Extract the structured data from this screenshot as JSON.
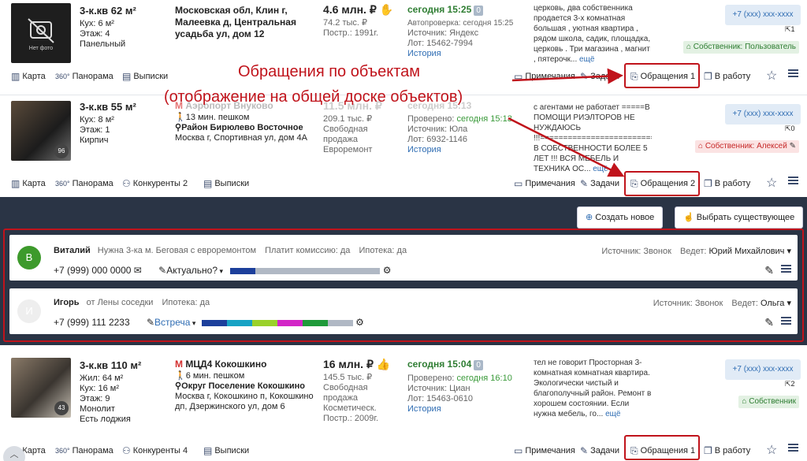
{
  "listings": [
    {
      "rooms": "3-к.кв 62 м²",
      "area1": "Кух: 6 м²",
      "area2": "Этаж: 4",
      "area3": "Панельный",
      "addr1": "Московская обл, Клин г,",
      "addr2": "Малеевка д, Центральная",
      "addr3": "усадьба ул, дом 12",
      "price": "4.6 млн. ₽",
      "price_m2": "74.2 тыс. ₽",
      "built": "Постр.: 1991г.",
      "time": "сегодня 15:25",
      "time_badge": "0",
      "checked": "Автопроверка: сегодня 15:25",
      "source": "Источник: Яндекс",
      "lot": "Лот: 15462-7994",
      "history": "История",
      "desc": "церковь, два собственника продается 3-х комнатная большая , уютная квартира , рядом школа, садик, площадка, церковь . Три магазина , магнит , пятерочк...",
      "more": "ещё",
      "phone": "+7 (xxx) xxx-xxxx",
      "phone_count": "1",
      "owner": "Собственник: Пользователь",
      "nophoto": "Нет фото"
    },
    {
      "rooms": "3-к.кв 55 м²",
      "area1": "Кух: 8 м²",
      "area2": "Этаж: 1",
      "area3": "Кирпич",
      "metro": "Аэропорт Внуково",
      "walk": "13 мин. пешком",
      "district": "Район Бирюлево Восточное",
      "addr": "Москва г, Спортивная ул, дом 4А",
      "price": "11.5 млн. ₽",
      "price_m2": "209.1 тыс. ₽",
      "sale1": "Свободная",
      "sale2": "продажа",
      "sale3": "Евроремонт",
      "time": "сегодня 15:13",
      "checked_label": "Проверено:",
      "checked_time": "сегодня 15:13",
      "source": "Источник: Юла",
      "lot": "Лот: 6932-1146",
      "history": "История",
      "desc1": "с агентами не работает =====В ПОМОЩИ РИЭЛТОРОВ НЕ НУЖДАЮСЬ",
      "desc2": "!!!================================",
      "desc3": "В СОБСТВЕННОСТИ БОЛЕЕ 5 ЛЕТ !!! ВСЯ МЕБЕЛЬ И ТЕХНИКА ОС...",
      "more": "ещё",
      "phone": "+7 (xxx) xxx-xxxx",
      "phone_count": "0",
      "owner": "Собственник: Алексей",
      "photo_count": "96"
    },
    {
      "rooms": "3-к.кв 110 м²",
      "area1": "Жил: 64 м²",
      "area2": "Кух: 16 м²",
      "area3": "Этаж: 9",
      "area4": "Монолит",
      "area5": "Есть лоджия",
      "metro": "МЦД4 Кокошкино",
      "walk": "6 мин. пешком",
      "district": "Округ Поселение Кокошкино",
      "addr1": "Москва г, Кокошкино п, Кокошкино",
      "addr2": "дп, Дзержинского ул, дом 6",
      "price": "16 млн. ₽",
      "price_m2": "145.5 тыс. ₽",
      "sale1": "Свободная",
      "sale2": "продажа",
      "sale3": "Косметическ.",
      "sale4": "Постр.: 2009г.",
      "time": "сегодня 15:04",
      "time_badge": "0",
      "checked_label": "Проверено:",
      "checked_time": "сегодня 16:10",
      "source": "Источник: Циан",
      "lot": "Лот: 15463-0610",
      "history": "История",
      "desc": "тел не говорит Просторная 3-комнатная комнатная квартира. Экологически чистый и благополучный район. Ремонт в хорошем состоянии. Если нужна мебель, го...",
      "more": "ещё",
      "phone": "+7 (xxx) xxx-xxxx",
      "phone_count": "2",
      "owner": "Собственник",
      "photo_count": "43"
    }
  ],
  "actions": {
    "map": "Карта",
    "pano": "Панорама",
    "competitors1": "Конкуренты 2",
    "competitors3": "Конкуренты 4",
    "extracts": "Выписки",
    "notes": "Примечания",
    "tasks": "Задачи",
    "req1": "Обращения 1",
    "req2": "Обращения 2",
    "req3": "Обращения 1",
    "work": "В работу",
    "pano360": "360°"
  },
  "annotation": {
    "line1": "Обращения по объектам",
    "line2": "(отображение на общей доске объектов)"
  },
  "panel": {
    "create": "Создать новое",
    "choose": "Выбрать существующее"
  },
  "requests": [
    {
      "initial": "В",
      "name": "Виталий",
      "need": "Нужна 3-ка м. Беговая с евроремонтом",
      "commission": "Платит комиссию: да",
      "mortgage": "Ипотека: да",
      "source": "Источник: Звонок",
      "agent_label": "Ведет:",
      "agent": "Юрий Михайлович",
      "phone": "+7 (999) 000 0000",
      "status": "Актуально?",
      "avatar_color": "#3d9a2c"
    },
    {
      "initial": "И",
      "name": "Игорь",
      "need": "от Лены соседки",
      "mortgage": "Ипотека: да",
      "source": "Источник: Звонок",
      "agent_label": "Ведет:",
      "agent": "Ольга",
      "phone": "+7 (999) 111 2233",
      "status": "Встреча",
      "avatar_color": "#eeeeee"
    }
  ]
}
